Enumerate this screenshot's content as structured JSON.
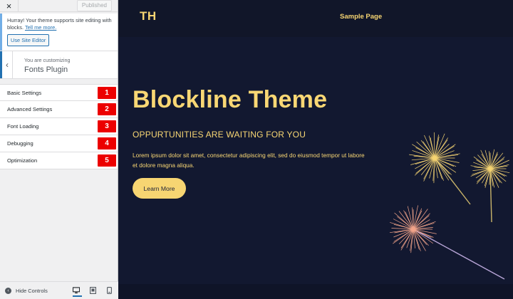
{
  "customizer": {
    "close_glyph": "×",
    "published_label": "Published",
    "notice": {
      "text": "Hurray! Your theme supports site editing with blocks.",
      "link": "Tell me more.",
      "button": "Use Site Editor"
    },
    "back_glyph": "‹",
    "customizing_label": "You are customizing",
    "section_title": "Fonts Plugin",
    "menu": [
      {
        "label": "Basic Settings",
        "badge": "1"
      },
      {
        "label": "Advanced Settings",
        "badge": "2"
      },
      {
        "label": "Font Loading",
        "badge": "3"
      },
      {
        "label": "Debugging",
        "badge": "4"
      },
      {
        "label": "Optimization",
        "badge": "5"
      }
    ],
    "footer": {
      "hide_label": "Hide Controls",
      "hide_glyph": "‹",
      "active_device": "desktop"
    }
  },
  "preview": {
    "logo": "TH",
    "nav_link": "Sample Page",
    "hero": {
      "title": "Blockline Theme",
      "subtitle": "OPPURTUNITIES ARE WAITING FOR YOU",
      "body": "Lorem ipsum dolor sit amet, consectetur adipiscing elit, sed do eiusmod tempor ut labore et dolore magna aliqua.",
      "cta": "Learn More"
    }
  },
  "colors": {
    "accent_yellow": "#f7d572",
    "page_bg": "#11162b",
    "badge_red": "#ec0000",
    "wp_blue": "#2271b1"
  }
}
